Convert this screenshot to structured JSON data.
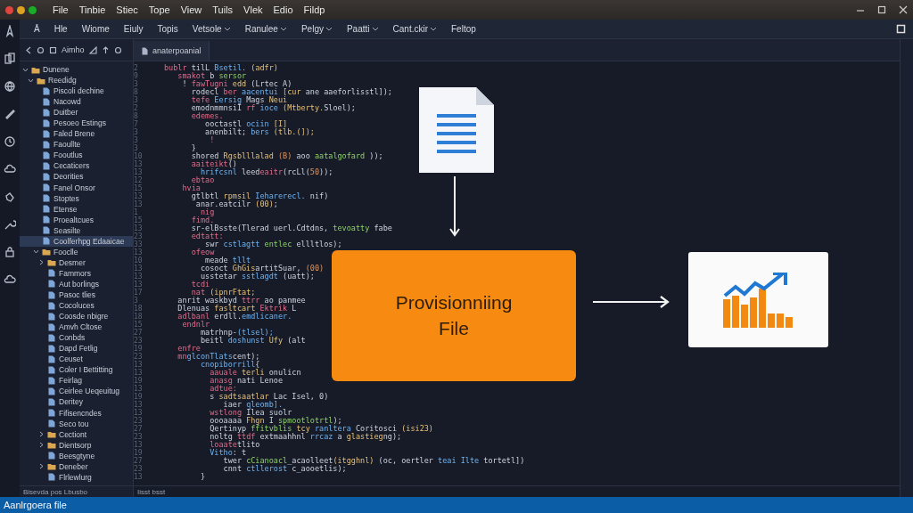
{
  "window": {
    "menu": [
      "File",
      "Tinbie",
      "Stiec",
      "Tope",
      "View",
      "Tuils",
      "Vlek",
      "Edio",
      "Fildp"
    ]
  },
  "toolbar": [
    {
      "label": "Ā",
      "has_menu": false
    },
    {
      "label": "Hle",
      "has_menu": false
    },
    {
      "label": "Wiome",
      "has_menu": false
    },
    {
      "label": "Eiuly",
      "has_menu": false
    },
    {
      "label": "Topis",
      "has_menu": false
    },
    {
      "label": "Vetsole",
      "has_menu": true
    },
    {
      "label": "Ranulee",
      "has_menu": true
    },
    {
      "label": "Pelgy",
      "has_menu": true
    },
    {
      "label": "Paatti",
      "has_menu": true
    },
    {
      "label": "Cant.ckir",
      "has_menu": true
    },
    {
      "label": "Feltop",
      "has_menu": false
    }
  ],
  "sidebar": {
    "title": "Aimho",
    "footer": "Bisevda pos Lbusbo",
    "tree": [
      {
        "label": "Dunene",
        "kind": "folder",
        "expanded": true,
        "selected": false,
        "children": [
          {
            "label": "Reedidg",
            "kind": "folder",
            "expanded": true,
            "selected": false,
            "children": [
              {
                "label": "Piscoli dechine",
                "kind": "file",
                "selected": false
              },
              {
                "label": "Nacowd",
                "kind": "file",
                "selected": false
              },
              {
                "label": "Duitber",
                "kind": "file",
                "selected": false
              },
              {
                "label": "Pesoeo Estings",
                "kind": "file",
                "selected": false
              },
              {
                "label": "Faled Brene",
                "kind": "file",
                "selected": false
              },
              {
                "label": "Faoullte",
                "kind": "file",
                "selected": false
              },
              {
                "label": "Fooutlus",
                "kind": "file",
                "selected": false
              },
              {
                "label": "Cecaticers",
                "kind": "file",
                "selected": false
              },
              {
                "label": "Deorities",
                "kind": "file",
                "selected": false
              },
              {
                "label": "Fanel Onsor",
                "kind": "file",
                "selected": false
              },
              {
                "label": "Stoptes",
                "kind": "file",
                "selected": false
              },
              {
                "label": "Etense",
                "kind": "file",
                "selected": false
              },
              {
                "label": "Proealtcues",
                "kind": "file",
                "selected": false
              },
              {
                "label": "Seasilte",
                "kind": "file",
                "selected": false
              },
              {
                "label": "Coolferhpg Edaaicae",
                "kind": "file",
                "selected": true
              },
              {
                "label": "Fooclle",
                "kind": "folder",
                "expanded": true,
                "selected": false,
                "children": [
                  {
                    "label": "Desmer",
                    "kind": "folder",
                    "expanded": false,
                    "selected": false
                  },
                  {
                    "label": "Fammors",
                    "kind": "file",
                    "selected": false
                  },
                  {
                    "label": "Aut borlings",
                    "kind": "file",
                    "selected": false
                  },
                  {
                    "label": "Pasoc tlies",
                    "kind": "file",
                    "selected": false
                  },
                  {
                    "label": "Cocoluces",
                    "kind": "file",
                    "selected": false
                  },
                  {
                    "label": "Coosde nbigre",
                    "kind": "file",
                    "selected": false
                  },
                  {
                    "label": "Amvh Cltose",
                    "kind": "file",
                    "selected": false
                  },
                  {
                    "label": "Conbds",
                    "kind": "file",
                    "selected": false
                  },
                  {
                    "label": "Dapd Fetlig",
                    "kind": "file",
                    "selected": false
                  },
                  {
                    "label": "Ceuset",
                    "kind": "file",
                    "selected": false
                  },
                  {
                    "label": "Coler I Bettitting",
                    "kind": "file",
                    "selected": false
                  },
                  {
                    "label": "Feirlag",
                    "kind": "file",
                    "selected": false
                  },
                  {
                    "label": "Ceirlee Ueqeuitug",
                    "kind": "file",
                    "selected": false
                  },
                  {
                    "label": "Deritey",
                    "kind": "file",
                    "selected": false
                  },
                  {
                    "label": "Fifisencndes",
                    "kind": "file",
                    "selected": false
                  },
                  {
                    "label": "Seco tou",
                    "kind": "file",
                    "selected": false
                  },
                  {
                    "label": "Cectiont",
                    "kind": "folder",
                    "expanded": false,
                    "selected": false
                  },
                  {
                    "label": "Dientsorp",
                    "kind": "folder",
                    "expanded": false,
                    "selected": false
                  },
                  {
                    "label": "Beesgtyne",
                    "kind": "file",
                    "selected": false
                  },
                  {
                    "label": "Deneber",
                    "kind": "folder",
                    "expanded": false,
                    "selected": false
                  },
                  {
                    "label": "Flrlewlurg",
                    "kind": "file",
                    "selected": false
                  }
                ]
              }
            ]
          }
        ]
      }
    ]
  },
  "editor": {
    "tab": "anaterpoanial",
    "panel_status": "Iisst bsst",
    "lines": [
      {
        "number": "2",
        "tokens": [
          {
            "kind": "kw",
            "text": "bublr"
          },
          {
            "kind": "plain",
            "text": " tilL "
          },
          {
            "kind": "var",
            "text": "Bsetil."
          },
          {
            "kind": "fn",
            "text": " (adfr)"
          }
        ]
      },
      {
        "number": "9",
        "tokens": [
          {
            "kind": "kw",
            "text": "   smakot"
          },
          {
            "kind": "plain",
            "text": " b "
          },
          {
            "kind": "str",
            "text": "sersor"
          }
        ]
      },
      {
        "number": "3",
        "tokens": [
          {
            "kind": "plain",
            "text": "    ! "
          },
          {
            "kind": "kw",
            "text": "fawTugni"
          },
          {
            "kind": "fn",
            "text": " edd"
          },
          {
            "kind": "plain",
            "text": " (Lrtec A)"
          }
        ]
      },
      {
        "number": "8",
        "tokens": [
          {
            "kind": "plain",
            "text": "      rodecl "
          },
          {
            "kind": "kw",
            "text": "ber "
          },
          {
            "kind": "var",
            "text": "aacentui "
          },
          {
            "kind": "fn",
            "text": "[cur "
          },
          {
            "kind": "plain",
            "text": "ane aaeforlisstl]);"
          }
        ]
      },
      {
        "number": "3",
        "tokens": [
          {
            "kind": "kw",
            "text": "      tefe "
          },
          {
            "kind": "var",
            "text": "Eersig "
          },
          {
            "kind": "plain",
            "text": "Mags "
          },
          {
            "kind": "fn",
            "text": "Neui"
          }
        ]
      },
      {
        "number": "2",
        "tokens": [
          {
            "kind": "plain",
            "text": "      emodnmmnsiI "
          },
          {
            "kind": "kw",
            "text": "rf "
          },
          {
            "kind": "var",
            "text": "ioce "
          },
          {
            "kind": "fn",
            "text": "(Mtberty."
          },
          {
            "kind": "plain",
            "text": "Sloel);"
          }
        ]
      },
      {
        "number": "8",
        "tokens": [
          {
            "kind": "kw",
            "text": "      edemes."
          }
        ]
      },
      {
        "number": "7",
        "tokens": [
          {
            "kind": "plain",
            "text": "         ooctastl "
          },
          {
            "kind": "var",
            "text": "ociin"
          },
          {
            "kind": "fn",
            "text": " [I]"
          }
        ]
      },
      {
        "number": "3",
        "tokens": [
          {
            "kind": "plain",
            "text": "         anenbilt; "
          },
          {
            "kind": "var",
            "text": "bers "
          },
          {
            "kind": "fn",
            "text": "(tlb.(]);"
          }
        ]
      },
      {
        "number": "3",
        "tokens": [
          {
            "kind": "kw",
            "text": "          !"
          }
        ]
      },
      {
        "number": "3",
        "tokens": [
          {
            "kind": "plain",
            "text": "      }"
          }
        ]
      },
      {
        "number": "10",
        "tokens": [
          {
            "kind": "plain",
            "text": "      shored "
          },
          {
            "kind": "fn",
            "text": "Rgsblllalad "
          },
          {
            "kind": "num",
            "text": "(B)"
          },
          {
            "kind": "plain",
            "text": " aoo "
          },
          {
            "kind": "str",
            "text": "aatalgofard"
          },
          {
            "kind": "plain",
            "text": " ));"
          }
        ]
      },
      {
        "number": "13",
        "tokens": [
          {
            "kind": "kw",
            "text": "      aaiteikt"
          },
          {
            "kind": "plain",
            "text": "()"
          }
        ]
      },
      {
        "number": "13",
        "tokens": [
          {
            "kind": "var",
            "text": "        hrifcsnl "
          },
          {
            "kind": "plain",
            "text": "leed"
          },
          {
            "kind": "kw",
            "text": "eaitr"
          },
          {
            "kind": "plain",
            "text": "(rcLl("
          },
          {
            "kind": "num",
            "text": "50"
          },
          {
            "kind": "plain",
            "text": "));"
          }
        ]
      },
      {
        "number": "12",
        "tokens": [
          {
            "kind": "kw",
            "text": "      ebtao"
          }
        ]
      },
      {
        "number": "15",
        "tokens": [
          {
            "kind": "kw",
            "text": "    hvia"
          }
        ]
      },
      {
        "number": "13",
        "tokens": [
          {
            "kind": "plain",
            "text": "      gtlbtl "
          },
          {
            "kind": "fn",
            "text": "rpmsil "
          },
          {
            "kind": "var",
            "text": "Ieharerecl. "
          },
          {
            "kind": "plain",
            "text": "nif)"
          }
        ]
      },
      {
        "number": "13",
        "tokens": [
          {
            "kind": "plain",
            "text": "       anar.eatcilr "
          },
          {
            "kind": "fn",
            "text": "(00)"
          },
          {
            "kind": "plain",
            "text": ";"
          }
        ]
      },
      {
        "number": "1",
        "tokens": [
          {
            "kind": "kw",
            "text": "        nig"
          }
        ]
      },
      {
        "number": "15",
        "tokens": [
          {
            "kind": "kw",
            "text": "      fimd."
          }
        ]
      },
      {
        "number": "13",
        "tokens": [
          {
            "kind": "plain",
            "text": "      sr-elBsste(Tlerad uerl.Cdtdns, "
          },
          {
            "kind": "str",
            "text": "tevoatty"
          },
          {
            "kind": "plain",
            "text": " fabe"
          }
        ]
      },
      {
        "number": "23",
        "tokens": [
          {
            "kind": "kw",
            "text": "      edtatt:"
          }
        ]
      },
      {
        "number": "33",
        "tokens": [
          {
            "kind": "plain",
            "text": "         swr "
          },
          {
            "kind": "var",
            "text": "cstlagtt "
          },
          {
            "kind": "str",
            "text": "entlec "
          },
          {
            "kind": "plain",
            "text": "ellltlos);"
          }
        ]
      },
      {
        "number": "13",
        "tokens": [
          {
            "kind": "kw",
            "text": "      ofeow"
          }
        ]
      },
      {
        "number": "10",
        "tokens": [
          {
            "kind": "plain",
            "text": "         meade "
          },
          {
            "kind": "var",
            "text": "tllt"
          }
        ]
      },
      {
        "number": "13",
        "tokens": [
          {
            "kind": "plain",
            "text": "        cosoct "
          },
          {
            "kind": "fn",
            "text": "GhGis"
          },
          {
            "kind": "plain",
            "text": "artitSuar, "
          },
          {
            "kind": "num",
            "text": "(00)"
          }
        ]
      },
      {
        "number": "13",
        "tokens": [
          {
            "kind": "plain",
            "text": "        usstetar "
          },
          {
            "kind": "var",
            "text": "sstlagdt"
          },
          {
            "kind": "plain",
            "text": " (uatt);"
          }
        ]
      },
      {
        "number": "13",
        "tokens": [
          {
            "kind": "kw",
            "text": "      tcdi"
          }
        ]
      },
      {
        "number": "17",
        "tokens": [
          {
            "kind": "kw",
            "text": "      nat "
          },
          {
            "kind": "fn",
            "text": "(ipnrFtat;"
          }
        ]
      },
      {
        "number": "3",
        "tokens": [
          {
            "kind": "plain",
            "text": "   anrit waskbyd "
          },
          {
            "kind": "kw",
            "text": "ttrr "
          },
          {
            "kind": "plain",
            "text": "ao panmee"
          }
        ]
      },
      {
        "number": "18",
        "tokens": [
          {
            "kind": "plain",
            "text": "   Dlenuas "
          },
          {
            "kind": "fn",
            "text": "fasltcart "
          },
          {
            "kind": "kw",
            "text": "Ektrik "
          },
          {
            "kind": "plain",
            "text": "L"
          }
        ]
      },
      {
        "number": "18",
        "tokens": [
          {
            "kind": "kw",
            "text": "   adlbanl "
          },
          {
            "kind": "plain",
            "text": "erdll."
          },
          {
            "kind": "var",
            "text": "emdlicaner."
          }
        ]
      },
      {
        "number": "15",
        "tokens": [
          {
            "kind": "kw",
            "text": "    endnlr"
          }
        ]
      },
      {
        "number": "27",
        "tokens": [
          {
            "kind": "plain",
            "text": "        matrhnp-"
          },
          {
            "kind": "var",
            "text": "(tlsel);"
          }
        ]
      },
      {
        "number": "23",
        "tokens": [
          {
            "kind": "plain",
            "text": "        beitl "
          },
          {
            "kind": "var",
            "text": "doshunst "
          },
          {
            "kind": "fn",
            "text": "Ufy"
          },
          {
            "kind": "plain",
            "text": " (alt"
          }
        ]
      },
      {
        "number": "19",
        "tokens": [
          {
            "kind": "kw",
            "text": "   enfre"
          }
        ]
      },
      {
        "number": "23",
        "tokens": [
          {
            "kind": "kw",
            "text": "   mn"
          },
          {
            "kind": "var",
            "text": "glconTlats"
          },
          {
            "kind": "plain",
            "text": "cent);"
          }
        ]
      },
      {
        "number": "13",
        "tokens": [
          {
            "kind": "var",
            "text": "        cnopiborrill"
          },
          {
            "kind": "plain",
            "text": "{"
          }
        ]
      },
      {
        "number": "13",
        "tokens": [
          {
            "kind": "kw",
            "text": "          aauale "
          },
          {
            "kind": "fn",
            "text": "terli "
          },
          {
            "kind": "plain",
            "text": "onulicn"
          }
        ]
      },
      {
        "number": "19",
        "tokens": [
          {
            "kind": "kw",
            "text": "          anasg "
          },
          {
            "kind": "plain",
            "text": "nati Lenoe"
          }
        ]
      },
      {
        "number": "13",
        "tokens": [
          {
            "kind": "kw",
            "text": "          adtue:"
          }
        ]
      },
      {
        "number": "19",
        "tokens": [
          {
            "kind": "plain",
            "text": "          s "
          },
          {
            "kind": "fn",
            "text": "sadtsaatlar "
          },
          {
            "kind": "plain",
            "text": "Lac Isel, 0)"
          }
        ]
      },
      {
        "number": "13",
        "tokens": [
          {
            "kind": "plain",
            "text": "             iaer "
          },
          {
            "kind": "var",
            "text": "qleomb]."
          }
        ]
      },
      {
        "number": "13",
        "tokens": [
          {
            "kind": "kw",
            "text": "          wstlong "
          },
          {
            "kind": "plain",
            "text": "Ilea suolr"
          }
        ]
      },
      {
        "number": "23",
        "tokens": [
          {
            "kind": "plain",
            "text": "          oooaaaa "
          },
          {
            "kind": "fn",
            "text": "Fhgn "
          },
          {
            "kind": "plain",
            "text": "I "
          },
          {
            "kind": "str",
            "text": "spmootlotrtl"
          },
          {
            "kind": "plain",
            "text": ");"
          }
        ]
      },
      {
        "number": "27",
        "tokens": [
          {
            "kind": "plain",
            "text": "          Qertinyp "
          },
          {
            "kind": "str",
            "text": "ffitvblis "
          },
          {
            "kind": "fn",
            "text": "tcy "
          },
          {
            "kind": "var",
            "text": "ranltera "
          },
          {
            "kind": "plain",
            "text": "Coritosci "
          },
          {
            "kind": "fn",
            "text": "(isi23)"
          }
        ]
      },
      {
        "number": "23",
        "tokens": [
          {
            "kind": "plain",
            "text": "          noltg "
          },
          {
            "kind": "kw",
            "text": "ttdf "
          },
          {
            "kind": "plain",
            "text": "extmaahhnl "
          },
          {
            "kind": "var",
            "text": "rrcaz "
          },
          {
            "kind": "plain",
            "text": "a "
          },
          {
            "kind": "fn",
            "text": "glastieg"
          },
          {
            "kind": "plain",
            "text": "ng);"
          }
        ]
      },
      {
        "number": "13",
        "tokens": [
          {
            "kind": "kw",
            "text": "          loaate"
          },
          {
            "kind": "plain",
            "text": "tlito"
          }
        ]
      },
      {
        "number": "19",
        "tokens": [
          {
            "kind": "var",
            "text": "          Vitho"
          },
          {
            "kind": "plain",
            "text": ": t"
          }
        ]
      },
      {
        "number": "27",
        "tokens": [
          {
            "kind": "plain",
            "text": "             twer "
          },
          {
            "kind": "str",
            "text": "cCianoacl"
          },
          {
            "kind": "plain",
            "text": "_acaolleet"
          },
          {
            "kind": "fn",
            "text": "(itgghnl) "
          },
          {
            "kind": "plain",
            "text": "(oc, oertler "
          },
          {
            "kind": "var",
            "text": "teai Ilte "
          },
          {
            "kind": "plain",
            "text": "tortetl])"
          }
        ]
      },
      {
        "number": "23",
        "tokens": [
          {
            "kind": "plain",
            "text": "             cnnt "
          },
          {
            "kind": "var",
            "text": "ctllerost "
          },
          {
            "kind": "plain",
            "text": "c_aooetlis);"
          }
        ]
      },
      {
        "number": "13",
        "tokens": [
          {
            "kind": "plain",
            "text": "        }"
          }
        ]
      }
    ]
  },
  "diagram": {
    "box_label": "Provisionniing File"
  },
  "status_bar": {
    "text": "Aanlrgoera file"
  }
}
